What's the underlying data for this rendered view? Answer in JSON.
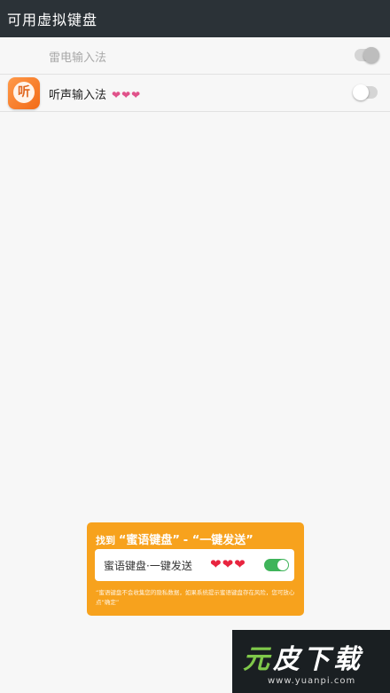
{
  "titlebar": {
    "title": "可用虚拟键盘"
  },
  "input_methods": [
    {
      "label": "雷电输入法",
      "enabled": true,
      "disabled": true
    },
    {
      "label": "听声输入法",
      "hearts": "❤❤❤",
      "enabled": false,
      "icon": "listen-app-icon",
      "icon_glyph": "听"
    }
  ],
  "tip": {
    "heading_prefix": "找到",
    "heading_app": "“蜜语键盘”",
    "heading_sep": " - ",
    "heading_action": "“一键发送”",
    "card_label": "蜜语键盘·一键发送",
    "card_hearts": "❤❤❤",
    "card_toggle_on": true,
    "note": "“蜜语键盘不会收集您的隐私数据，如果系统提示蜜语键盘存在风险，您可放心点“确定”"
  },
  "watermark": {
    "brand_a": "元",
    "brand_b": "皮",
    "brand_c": "下载",
    "url": "www.yuanpi.com"
  },
  "colors": {
    "titlebar": "#2b3237",
    "tip_bg": "#f7a21d",
    "toggle_on": "#3fb45a",
    "hearts": "#e8243f"
  }
}
